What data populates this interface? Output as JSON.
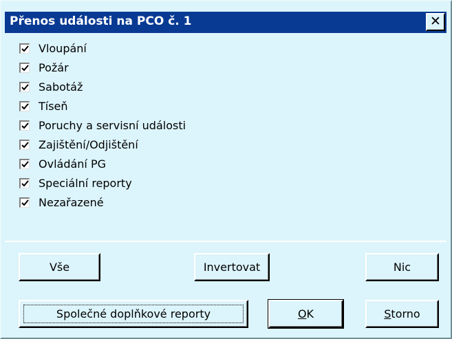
{
  "dialog": {
    "title": "Přenos události na PCO č. 1",
    "close_glyph": "✕"
  },
  "options": [
    {
      "label": "Vloupání",
      "checked": true
    },
    {
      "label": "Požár",
      "checked": true
    },
    {
      "label": "Sabotáž",
      "checked": true
    },
    {
      "label": "Tíseň",
      "checked": true
    },
    {
      "label": "Poruchy a servisní události",
      "checked": true
    },
    {
      "label": "Zajištění/Odjištění",
      "checked": true
    },
    {
      "label": "Ovládání PG",
      "checked": true
    },
    {
      "label": "Speciální reporty",
      "checked": true
    },
    {
      "label": "Nezařazené",
      "checked": true
    }
  ],
  "buttons": {
    "all": "Vše",
    "invert": "Invertovat",
    "none": "Nic",
    "common_reports": "Společné doplňkové reporty",
    "ok_mnemonic": "O",
    "ok_rest": "K",
    "cancel_mnemonic": "S",
    "cancel_rest": "torno"
  },
  "colors": {
    "titlebar": "#083a93",
    "face": "#dcf4fb"
  }
}
